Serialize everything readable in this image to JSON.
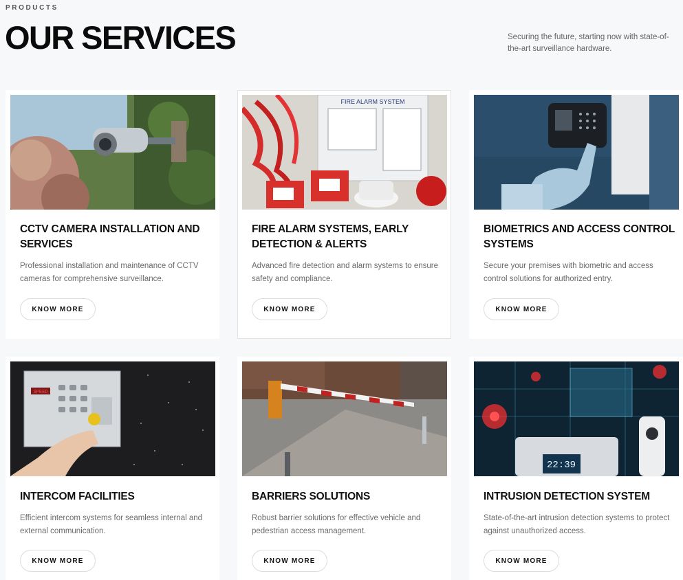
{
  "header": {
    "eyebrow": "PRODUCTS",
    "title": "OUR SERVICES",
    "tagline": "Securing the future, starting now with state-of-the-art surveillance hardware."
  },
  "services": [
    {
      "title": "CCTV CAMERA INSTALLATION AND SERVICES",
      "description": "Professional installation and maintenance of CCTV cameras for comprehensive surveillance.",
      "button": "KNOW MORE",
      "image_text": ""
    },
    {
      "title": "FIRE ALARM SYSTEMS, EARLY DETECTION & ALERTS",
      "description": "Advanced fire detection and alarm systems to ensure safety and compliance.",
      "button": "KNOW MORE",
      "image_text": "FIRE ALARM SYSTEM"
    },
    {
      "title": "BIOMETRICS AND ACCESS CONTROL SYSTEMS",
      "description": "Secure your premises with biometric and access control solutions for authorized entry.",
      "button": "KNOW MORE",
      "image_text": ""
    },
    {
      "title": "INTERCOM FACILITIES",
      "description": "Efficient intercom systems for seamless internal and external communication.",
      "button": "KNOW MORE",
      "image_text": "SPEED"
    },
    {
      "title": "BARRIERS SOLUTIONS",
      "description": "Robust barrier solutions for effective vehicle and pedestrian access management.",
      "button": "KNOW MORE",
      "image_text": ""
    },
    {
      "title": "INTRUSION DETECTION SYSTEM",
      "description": "State-of-the-art intrusion detection systems to protect against unauthorized access.",
      "button": "KNOW MORE",
      "image_text": "22:39"
    }
  ]
}
